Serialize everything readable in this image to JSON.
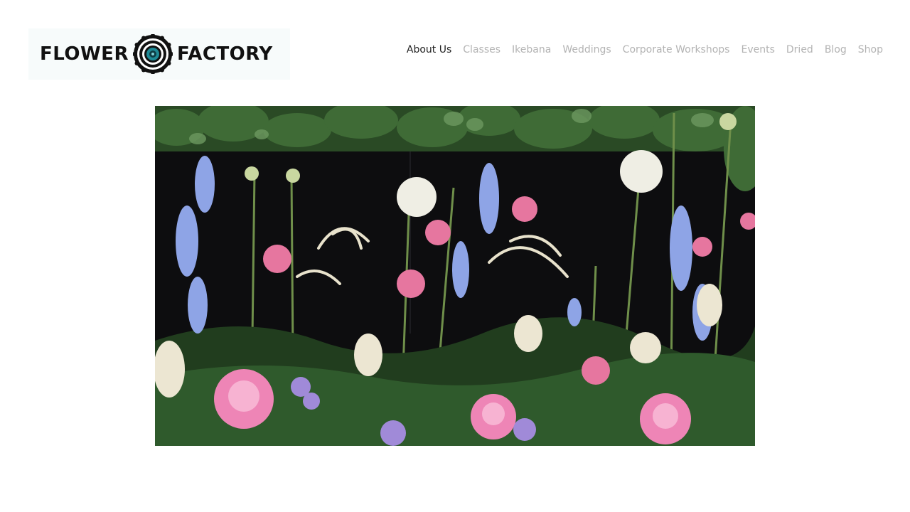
{
  "brand": {
    "name_left": "FLOWER",
    "name_right": "FACTORY",
    "logo_icon": "flower-mandala-icon",
    "accent_color": "#1f8a96"
  },
  "nav": {
    "items": [
      {
        "label": "About Us",
        "active": true
      },
      {
        "label": "Classes",
        "active": false
      },
      {
        "label": "Ikebana",
        "active": false
      },
      {
        "label": "Weddings",
        "active": false
      },
      {
        "label": "Corporate Workshops",
        "active": false
      },
      {
        "label": "Events",
        "active": false
      },
      {
        "label": "Dried",
        "active": false
      },
      {
        "label": "Blog",
        "active": false
      },
      {
        "label": "Shop",
        "active": false
      }
    ]
  },
  "hero": {
    "subject": "floral-arrangement-photo",
    "colors": {
      "background": "#0d0d0f",
      "foliage": "#2f5a2c",
      "pink": "#e6769f",
      "blue": "#8ea4e6",
      "cream": "#ece6d2"
    }
  }
}
